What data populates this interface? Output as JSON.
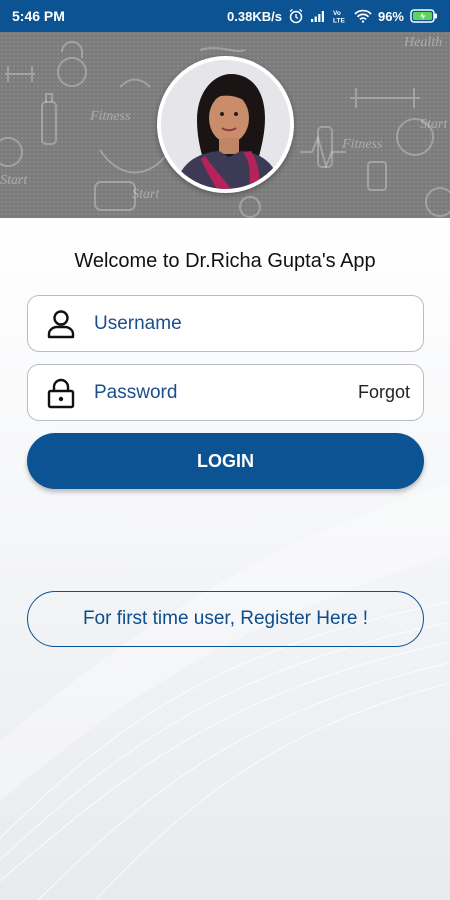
{
  "status_bar": {
    "time": "5:46 PM",
    "speed": "0.38KB/s",
    "battery": "96%",
    "icons": [
      "alarm-icon",
      "signal-icon",
      "volte-icon",
      "wifi-icon",
      "battery-icon"
    ]
  },
  "header": {
    "background_icons": "fitness-doodles",
    "doodle_words": [
      "Health",
      "Fitness",
      "Start",
      "Fitness",
      "Start",
      "Start"
    ],
    "avatar": "profile-photo"
  },
  "welcome_text": "Welcome to Dr.Richa Gupta's App",
  "login_form": {
    "username_placeholder": "Username",
    "password_placeholder": "Password",
    "forgot_label": "Forgot",
    "login_label": "LOGIN"
  },
  "register_label": "For first time user, Register Here !",
  "colors": {
    "primary": "#0c5394",
    "banner_gray": "#7b7b7b",
    "field_border": "#b9bcc2",
    "text_blue": "#1a4f8b"
  }
}
